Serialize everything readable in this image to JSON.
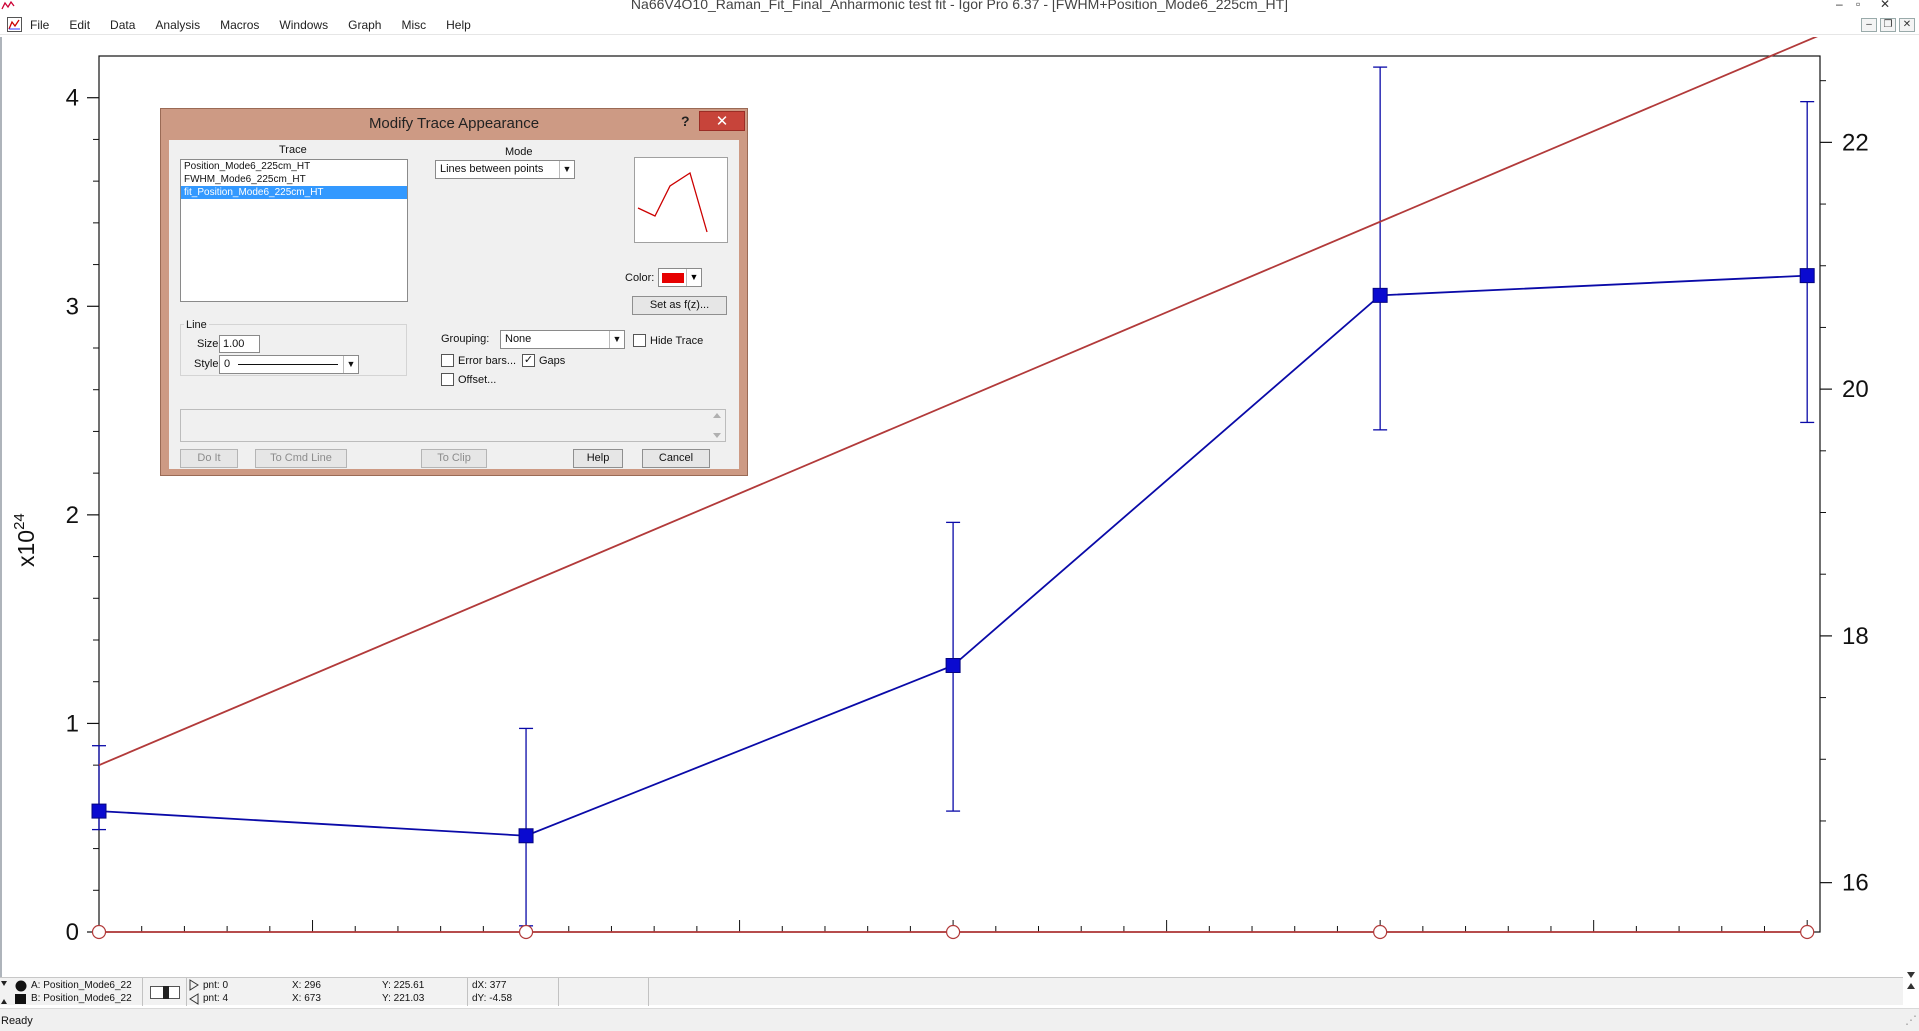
{
  "window": {
    "title": "Na66V4O10_Raman_Fit_Final_Anharmonic test fit - Igor Pro 6.37 - [FWHM+Position_Mode6_225cm_HT]"
  },
  "menubar": {
    "items": [
      "File",
      "Edit",
      "Data",
      "Analysis",
      "Macros",
      "Windows",
      "Graph",
      "Misc",
      "Help"
    ]
  },
  "dialog": {
    "title": "Modify Trace Appearance",
    "help_glyph": "?",
    "close_glyph": "✕",
    "trace_label": "Trace",
    "traces": [
      "Position_Mode6_225cm_HT",
      "FWHM_Mode6_225cm_HT",
      "fit_Position_Mode6_225cm_HT"
    ],
    "selected_trace_index": 2,
    "mode_label": "Mode",
    "mode_value": "Lines between points",
    "color_label": "Color:",
    "color_value": "#e60000",
    "set_as_fz": "Set as f(z)...",
    "line_group_label": "Line",
    "size_label": "Size:",
    "size_value": "1.00",
    "style_label": "Style:",
    "style_value": "0",
    "grouping_label": "Grouping:",
    "grouping_value": "None",
    "hide_trace_label": "Hide Trace",
    "error_bars_label": "Error bars...",
    "gaps_label": "Gaps",
    "offset_label": "Offset...",
    "checks": {
      "hide_trace": false,
      "error_bars": false,
      "gaps": true,
      "offset": false
    },
    "buttons": {
      "do_it": "Do It",
      "to_cmd_line": "To Cmd Line",
      "to_clip": "To Clip",
      "help": "Help",
      "cancel": "Cancel"
    }
  },
  "chart_data": {
    "type": "line",
    "left_axis": {
      "range": [
        0,
        4.2
      ],
      "ticks": [
        "0",
        "1",
        "2",
        "3",
        "4"
      ],
      "exponent_label": "x10",
      "exponent": "24"
    },
    "right_axis": {
      "range": [
        15.6,
        22.7
      ],
      "ticks": [
        "16",
        "18",
        "20",
        "22"
      ]
    },
    "grid": false,
    "series": [
      {
        "axis": "right",
        "color": "#0a0aa8",
        "marker": "square",
        "x": [
          0,
          1,
          2,
          3,
          4
        ],
        "y": [
          16.58,
          16.38,
          17.76,
          20.76,
          20.92
        ],
        "error_low": [
          16.43,
          15.65,
          16.58,
          19.67,
          19.73
        ],
        "error_high": [
          17.11,
          17.25,
          18.92,
          22.61,
          22.33
        ]
      },
      {
        "axis": "left",
        "color": "#b23a3a",
        "marker": "none",
        "x": [
          0,
          4.03
        ],
        "y": [
          0.8,
          4.3
        ]
      },
      {
        "axis": "left",
        "color": "#b23a3a",
        "marker": "circle",
        "x": [
          0,
          1,
          2,
          3,
          4
        ],
        "y": [
          0,
          0,
          0,
          0,
          0
        ]
      }
    ]
  },
  "infobar": {
    "cursor_a_label": "A: Position_Mode6_22",
    "cursor_b_label": "B: Position_Mode6_22",
    "pnt_a": "pnt: 0",
    "pnt_b": "pnt: 4",
    "x_a": "X: 296",
    "x_b": "X: 673",
    "y_a": "Y: 225.61",
    "y_b": "Y: 221.03",
    "dx": "dX: 377",
    "dy": "dY: -4.58"
  },
  "status": {
    "text": "Ready"
  }
}
